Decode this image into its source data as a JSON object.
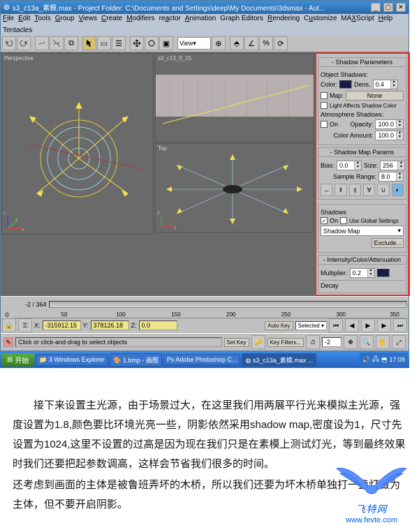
{
  "window": {
    "title": "s3_c13a_素模.max  -  Project Folder: C:\\Documents and Settings\\deep\\My Documents\\3dsmax  -  Aut..."
  },
  "menu": {
    "file": "File",
    "edit": "Edit",
    "tools": "Tools",
    "group": "Group",
    "views": "Views",
    "create": "Create",
    "modifiers": "Modifiers",
    "reactor": "reactor",
    "animation": "Animation",
    "graph": "Graph Editors",
    "rendering": "Rendering",
    "customize": "Customize",
    "maxscript": "MAXScript",
    "help": "Help",
    "tentacles": "Tentacles"
  },
  "toolbar": {
    "dropdown": "View"
  },
  "viewports": {
    "persp_label": "Perspective",
    "cam_label": "s3_c13_0_15",
    "top_label": "Top"
  },
  "panel": {
    "shadowParams": {
      "title": "-     Shadow Parameters",
      "objShadows": "Object Shadows:",
      "color": "Color:",
      "dens": "Dens.",
      "densVal": "0.4",
      "map": "Map:",
      "mapVal": "None",
      "lightAffects": "Light Affects Shadow Color",
      "atmoShadows": "Atmosphere Shadows:",
      "on": "On",
      "opacity": "Opacity:",
      "opacityVal": "100.0",
      "colorAmt": "Color Amount:",
      "colorAmtVal": "100.0"
    },
    "shadowMap": {
      "title": "-     Shadow Map Params",
      "bias": "Bias:",
      "biasVal": "0.0",
      "size": "Size:",
      "sizeVal": "256",
      "sampleRange": "Sample Range:",
      "sampleRangeVal": "8.0"
    },
    "shadows": {
      "group": "Shadows",
      "on": "On",
      "useGlobal": "Use Global Settings",
      "type": "Shadow Map",
      "exclude": "Exclude..."
    },
    "intensity": {
      "title": "-  Intensity/Color/Attenuation",
      "multiplier": "Multiplier:",
      "multiplierVal": "0.2",
      "decay": "Decay"
    }
  },
  "timeline": {
    "frame": "-2 / 364",
    "x": "X:",
    "xv": "-315912.15",
    "y": "Y:",
    "yv": "378126.18",
    "z": "Z:",
    "zv": "0.0",
    "status": "Click or click-and-drag to select objects",
    "autokey": "Auto Key",
    "setkey": "Set Key",
    "selected": "Selected",
    "keyfilters": "Key Filters...",
    "curframe": "-2"
  },
  "taskbar": {
    "start": "开始",
    "explorer": "3 Windows Explorer",
    "paint": "1.bmp - 画图",
    "photoshop": "Adobe Photoshop C...",
    "max": "s3_c13a_素模.max ...",
    "time": "17:09"
  },
  "article": {
    "p1": "接下来设置主光源，由于场景过大，在这里我们用两展平行光来模拟主光源，强度设置为1.8,颜色要比环境光亮一些，阴影依然采用shadow map,密度设为1，尺寸先设置为1024,这里不设置的过高是因为现在我们只是在素模上测试灯光，等到最终效果时我们还要把起参数调高，这样会节省我们很多的时间。",
    "p2": "还考虑到画面的主体是被鲁班弄坏的木桥，所以我们还要为坏木桥单独打一盏灯做为主体，但不要开启阴影。"
  },
  "logo": {
    "name": "飞特网",
    "url": "www.fevte.com"
  }
}
